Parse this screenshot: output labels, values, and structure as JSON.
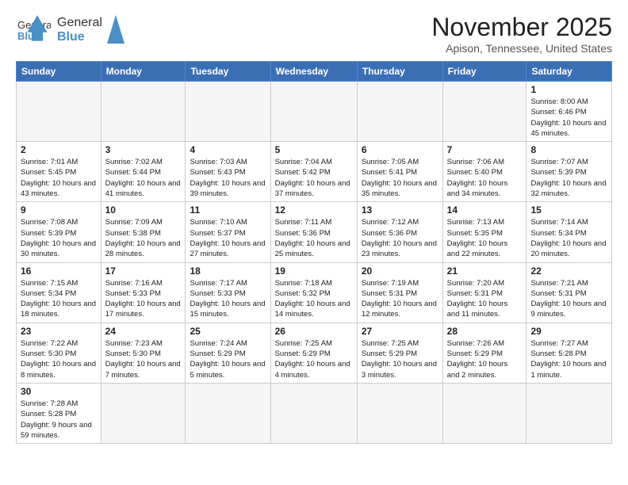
{
  "header": {
    "logo_general": "General",
    "logo_blue": "Blue",
    "month_title": "November 2025",
    "location": "Apison, Tennessee, United States"
  },
  "weekdays": [
    "Sunday",
    "Monday",
    "Tuesday",
    "Wednesday",
    "Thursday",
    "Friday",
    "Saturday"
  ],
  "weeks": [
    [
      {
        "day": "",
        "info": ""
      },
      {
        "day": "",
        "info": ""
      },
      {
        "day": "",
        "info": ""
      },
      {
        "day": "",
        "info": ""
      },
      {
        "day": "",
        "info": ""
      },
      {
        "day": "",
        "info": ""
      },
      {
        "day": "1",
        "info": "Sunrise: 8:00 AM\nSunset: 6:46 PM\nDaylight: 10 hours\nand 45 minutes."
      }
    ],
    [
      {
        "day": "2",
        "info": "Sunrise: 7:01 AM\nSunset: 5:45 PM\nDaylight: 10 hours\nand 43 minutes."
      },
      {
        "day": "3",
        "info": "Sunrise: 7:02 AM\nSunset: 5:44 PM\nDaylight: 10 hours\nand 41 minutes."
      },
      {
        "day": "4",
        "info": "Sunrise: 7:03 AM\nSunset: 5:43 PM\nDaylight: 10 hours\nand 39 minutes."
      },
      {
        "day": "5",
        "info": "Sunrise: 7:04 AM\nSunset: 5:42 PM\nDaylight: 10 hours\nand 37 minutes."
      },
      {
        "day": "6",
        "info": "Sunrise: 7:05 AM\nSunset: 5:41 PM\nDaylight: 10 hours\nand 35 minutes."
      },
      {
        "day": "7",
        "info": "Sunrise: 7:06 AM\nSunset: 5:40 PM\nDaylight: 10 hours\nand 34 minutes."
      },
      {
        "day": "8",
        "info": "Sunrise: 7:07 AM\nSunset: 5:39 PM\nDaylight: 10 hours\nand 32 minutes."
      }
    ],
    [
      {
        "day": "9",
        "info": "Sunrise: 7:08 AM\nSunset: 5:39 PM\nDaylight: 10 hours\nand 30 minutes."
      },
      {
        "day": "10",
        "info": "Sunrise: 7:09 AM\nSunset: 5:38 PM\nDaylight: 10 hours\nand 28 minutes."
      },
      {
        "day": "11",
        "info": "Sunrise: 7:10 AM\nSunset: 5:37 PM\nDaylight: 10 hours\nand 27 minutes."
      },
      {
        "day": "12",
        "info": "Sunrise: 7:11 AM\nSunset: 5:36 PM\nDaylight: 10 hours\nand 25 minutes."
      },
      {
        "day": "13",
        "info": "Sunrise: 7:12 AM\nSunset: 5:36 PM\nDaylight: 10 hours\nand 23 minutes."
      },
      {
        "day": "14",
        "info": "Sunrise: 7:13 AM\nSunset: 5:35 PM\nDaylight: 10 hours\nand 22 minutes."
      },
      {
        "day": "15",
        "info": "Sunrise: 7:14 AM\nSunset: 5:34 PM\nDaylight: 10 hours\nand 20 minutes."
      }
    ],
    [
      {
        "day": "16",
        "info": "Sunrise: 7:15 AM\nSunset: 5:34 PM\nDaylight: 10 hours\nand 18 minutes."
      },
      {
        "day": "17",
        "info": "Sunrise: 7:16 AM\nSunset: 5:33 PM\nDaylight: 10 hours\nand 17 minutes."
      },
      {
        "day": "18",
        "info": "Sunrise: 7:17 AM\nSunset: 5:33 PM\nDaylight: 10 hours\nand 15 minutes."
      },
      {
        "day": "19",
        "info": "Sunrise: 7:18 AM\nSunset: 5:32 PM\nDaylight: 10 hours\nand 14 minutes."
      },
      {
        "day": "20",
        "info": "Sunrise: 7:19 AM\nSunset: 5:31 PM\nDaylight: 10 hours\nand 12 minutes."
      },
      {
        "day": "21",
        "info": "Sunrise: 7:20 AM\nSunset: 5:31 PM\nDaylight: 10 hours\nand 11 minutes."
      },
      {
        "day": "22",
        "info": "Sunrise: 7:21 AM\nSunset: 5:31 PM\nDaylight: 10 hours\nand 9 minutes."
      }
    ],
    [
      {
        "day": "23",
        "info": "Sunrise: 7:22 AM\nSunset: 5:30 PM\nDaylight: 10 hours\nand 8 minutes."
      },
      {
        "day": "24",
        "info": "Sunrise: 7:23 AM\nSunset: 5:30 PM\nDaylight: 10 hours\nand 7 minutes."
      },
      {
        "day": "25",
        "info": "Sunrise: 7:24 AM\nSunset: 5:29 PM\nDaylight: 10 hours\nand 5 minutes."
      },
      {
        "day": "26",
        "info": "Sunrise: 7:25 AM\nSunset: 5:29 PM\nDaylight: 10 hours\nand 4 minutes."
      },
      {
        "day": "27",
        "info": "Sunrise: 7:25 AM\nSunset: 5:29 PM\nDaylight: 10 hours\nand 3 minutes."
      },
      {
        "day": "28",
        "info": "Sunrise: 7:26 AM\nSunset: 5:29 PM\nDaylight: 10 hours\nand 2 minutes."
      },
      {
        "day": "29",
        "info": "Sunrise: 7:27 AM\nSunset: 5:28 PM\nDaylight: 10 hours\nand 1 minute."
      }
    ],
    [
      {
        "day": "30",
        "info": "Sunrise: 7:28 AM\nSunset: 5:28 PM\nDaylight: 9 hours\nand 59 minutes."
      },
      {
        "day": "",
        "info": ""
      },
      {
        "day": "",
        "info": ""
      },
      {
        "day": "",
        "info": ""
      },
      {
        "day": "",
        "info": ""
      },
      {
        "day": "",
        "info": ""
      },
      {
        "day": "",
        "info": ""
      }
    ]
  ]
}
